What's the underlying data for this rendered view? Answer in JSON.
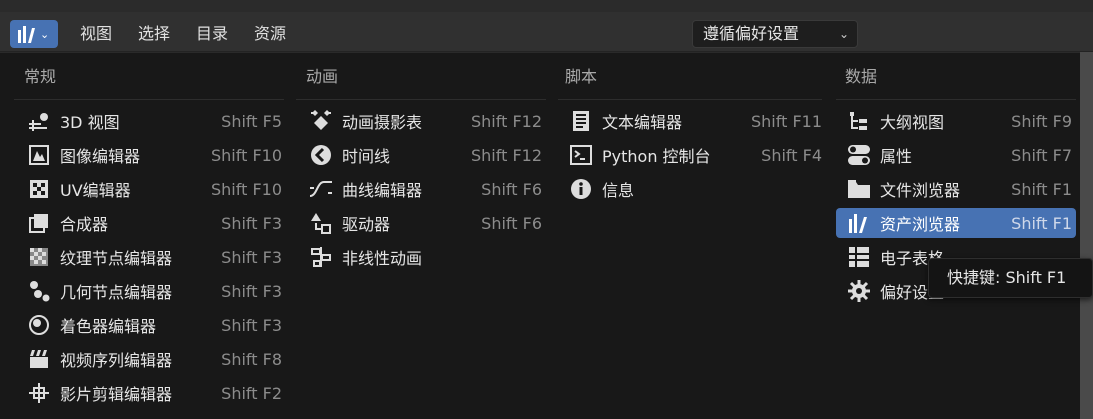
{
  "header": {
    "menu": [
      "视图",
      "选择",
      "目录",
      "资源"
    ],
    "preference_select": "遵循偏好设置"
  },
  "columns": [
    {
      "heading": "常规",
      "items": [
        {
          "label": "3D 视图",
          "shortcut": "Shift F5",
          "icon": "3d-viewport-icon"
        },
        {
          "label": "图像编辑器",
          "shortcut": "Shift F10",
          "icon": "image-editor-icon"
        },
        {
          "label": "UV编辑器",
          "shortcut": "Shift F10",
          "icon": "uv-editor-icon"
        },
        {
          "label": "合成器",
          "shortcut": "Shift F3",
          "icon": "compositor-icon"
        },
        {
          "label": "纹理节点编辑器",
          "shortcut": "Shift F3",
          "icon": "texture-node-icon"
        },
        {
          "label": "几何节点编辑器",
          "shortcut": "Shift F3",
          "icon": "geometry-node-icon"
        },
        {
          "label": "着色器编辑器",
          "shortcut": "Shift F3",
          "icon": "shader-editor-icon"
        },
        {
          "label": "视频序列编辑器",
          "shortcut": "Shift F8",
          "icon": "video-sequencer-icon"
        },
        {
          "label": "影片剪辑编辑器",
          "shortcut": "Shift F2",
          "icon": "movie-clip-icon"
        }
      ]
    },
    {
      "heading": "动画",
      "items": [
        {
          "label": "动画摄影表",
          "shortcut": "Shift F12",
          "icon": "dope-sheet-icon"
        },
        {
          "label": "时间线",
          "shortcut": "Shift F12",
          "icon": "timeline-icon"
        },
        {
          "label": "曲线编辑器",
          "shortcut": "Shift F6",
          "icon": "graph-editor-icon"
        },
        {
          "label": "驱动器",
          "shortcut": "Shift F6",
          "icon": "drivers-icon"
        },
        {
          "label": "非线性动画",
          "shortcut": "",
          "icon": "nla-icon"
        }
      ]
    },
    {
      "heading": "脚本",
      "items": [
        {
          "label": "文本编辑器",
          "shortcut": "Shift F11",
          "icon": "text-editor-icon"
        },
        {
          "label": "Python 控制台",
          "shortcut": "Shift F4",
          "icon": "python-console-icon"
        },
        {
          "label": "信息",
          "shortcut": "",
          "icon": "info-icon"
        }
      ]
    },
    {
      "heading": "数据",
      "items": [
        {
          "label": "大纲视图",
          "shortcut": "Shift F9",
          "icon": "outliner-icon"
        },
        {
          "label": "属性",
          "shortcut": "Shift F7",
          "icon": "properties-icon"
        },
        {
          "label": "文件浏览器",
          "shortcut": "Shift F1",
          "icon": "file-browser-icon"
        },
        {
          "label": "资产浏览器",
          "shortcut": "Shift F1",
          "icon": "asset-browser-icon"
        },
        {
          "label": "电子表格",
          "shortcut": "",
          "icon": "spreadsheet-icon"
        },
        {
          "label": "偏好设置",
          "shortcut": "",
          "icon": "preferences-icon"
        }
      ]
    }
  ],
  "tooltip": "快捷键: Shift F1",
  "colors": {
    "accent": "#4772b3",
    "panel": "#181818",
    "header": "#303030"
  }
}
